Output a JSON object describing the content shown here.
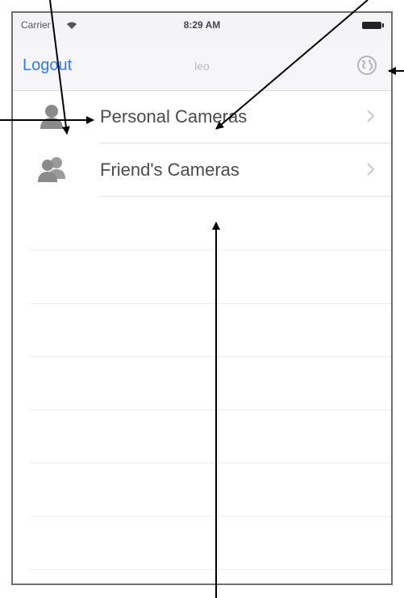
{
  "status_bar": {
    "carrier": "Carrier",
    "time": "8:29 AM"
  },
  "nav_bar": {
    "left_button": "Logout",
    "title": "leo",
    "right_icon": "globe-icon"
  },
  "table": {
    "rows": [
      {
        "label": "Personal Cameras",
        "icon": "person-icon"
      },
      {
        "label": "Friend's Cameras",
        "icon": "people-icon"
      }
    ]
  },
  "colors": {
    "accent": "#2f7cf6",
    "icon_gray": "#8a8a8a"
  }
}
